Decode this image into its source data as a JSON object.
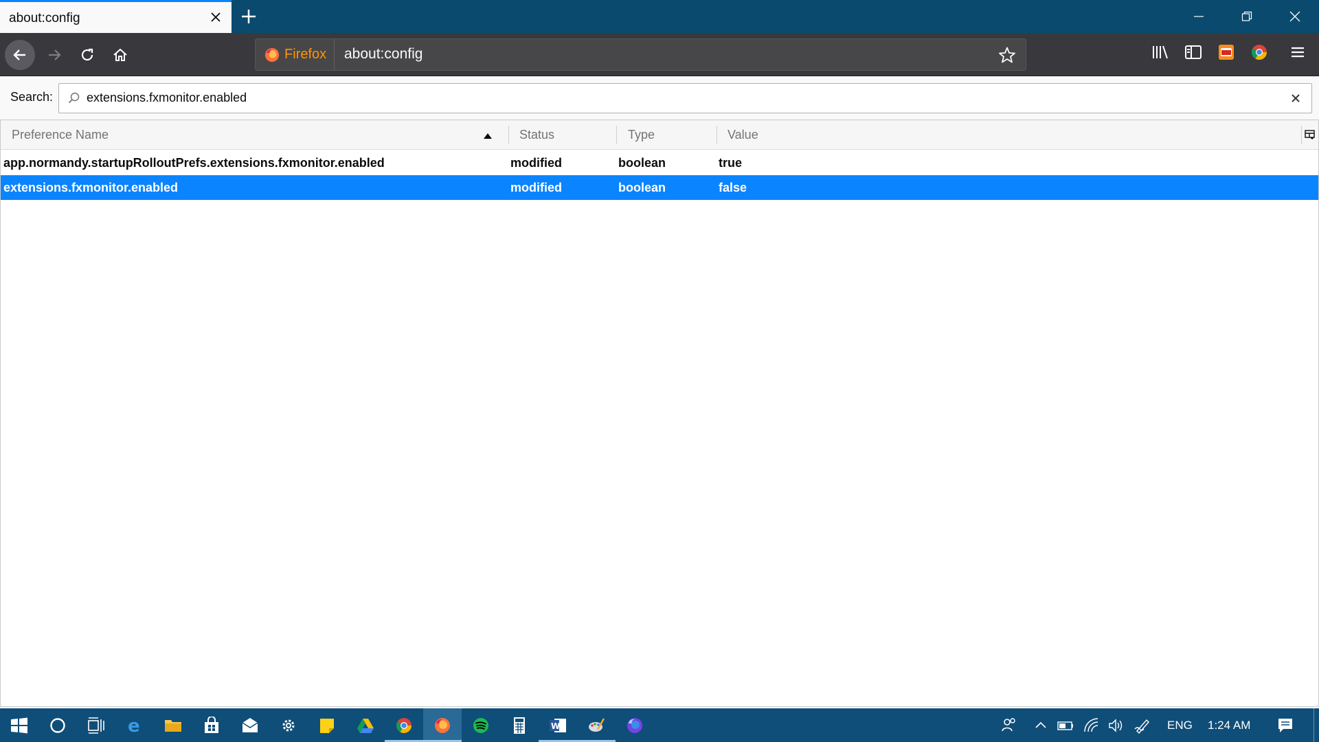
{
  "tab": {
    "title": "about:config"
  },
  "urlbar": {
    "identity_label": "Firefox",
    "url": "about:config"
  },
  "search": {
    "label": "Search:",
    "value": "extensions.fxmonitor.enabled"
  },
  "columns": {
    "name": "Preference Name",
    "status": "Status",
    "type": "Type",
    "value": "Value"
  },
  "rows": [
    {
      "name": "app.normandy.startupRolloutPrefs.extensions.fxmonitor.enabled",
      "status": "modified",
      "type": "boolean",
      "value": "true",
      "selected": false
    },
    {
      "name": "extensions.fxmonitor.enabled",
      "status": "modified",
      "type": "boolean",
      "value": "false",
      "selected": true
    }
  ],
  "taskbar": {
    "apps": [
      "start-icon",
      "cortana-icon",
      "task-view-icon",
      "edge-icon",
      "file-explorer-icon",
      "store-icon",
      "mail-icon",
      "settings-icon",
      "sticky-notes-icon",
      "google-drive-icon",
      "chrome-icon",
      "firefox-icon",
      "spotify-icon",
      "calculator-icon",
      "word-icon",
      "paint-icon",
      "firefox-nightly-icon"
    ],
    "language": "ENG",
    "time": "1:24 AM"
  },
  "colors": {
    "accent": "#0a84ff",
    "titlebar": "#0a4a6e",
    "toolbar": "#38383d",
    "taskbar": "#0f4e78"
  }
}
